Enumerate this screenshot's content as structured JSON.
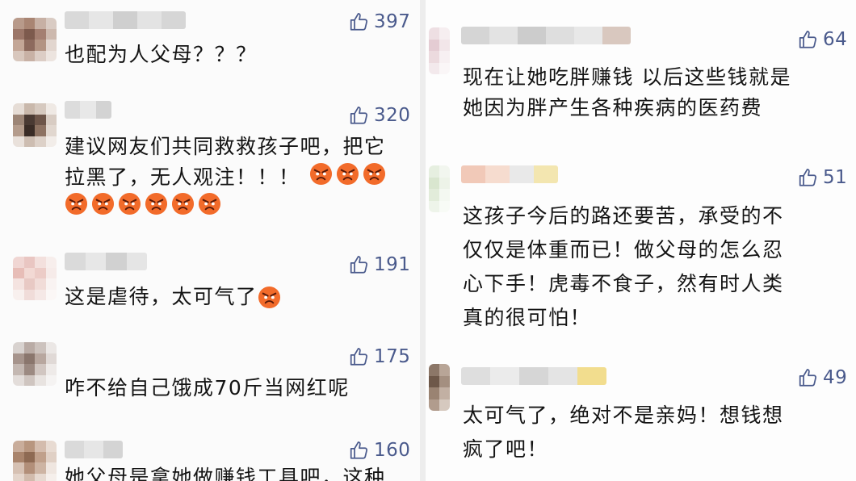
{
  "left_comments": [
    {
      "likes": "397",
      "text": "也配为人父母？？？",
      "emoji_count": 0,
      "emoji_label": "",
      "emoji_line2": 0
    },
    {
      "likes": "320",
      "text": "建议网友们共同救救孩子吧，把它\n拉黑了，无人观注！！！",
      "emoji_count": 3,
      "emoji_label": "angry-face-icon",
      "emoji_line2": 6
    },
    {
      "likes": "191",
      "text": "这是虐待，太可气了",
      "emoji_count": 1,
      "emoji_label": "angry-face-icon",
      "emoji_line2": 0
    },
    {
      "likes": "175",
      "text": "咋不给自己饿成70斤当网红呢",
      "emoji_count": 0,
      "emoji_label": "",
      "emoji_line2": 0
    },
    {
      "likes": "160",
      "text": "她父母是拿她做赚钱工具吧，这种",
      "emoji_count": 0,
      "emoji_label": "",
      "emoji_line2": 0
    }
  ],
  "right_comments": [
    {
      "likes": "64",
      "text": "现在让她吃胖赚钱 以后这些钱就是\n她因为胖产生各种疾病的医药费"
    },
    {
      "likes": "51",
      "text": "这孩子今后的路还要苦，承受的不\n仅仅是体重而已！做父母的怎么忍\n心下手！虎毒不食子，然有时人类\n真的很可怕！"
    },
    {
      "likes": "49",
      "text": "太可气了，绝对不是亲妈！想钱想\n疯了吧！"
    }
  ],
  "colors": {
    "like": "#4a5a8c",
    "text": "#141414",
    "emoji": "#f26b2a"
  }
}
